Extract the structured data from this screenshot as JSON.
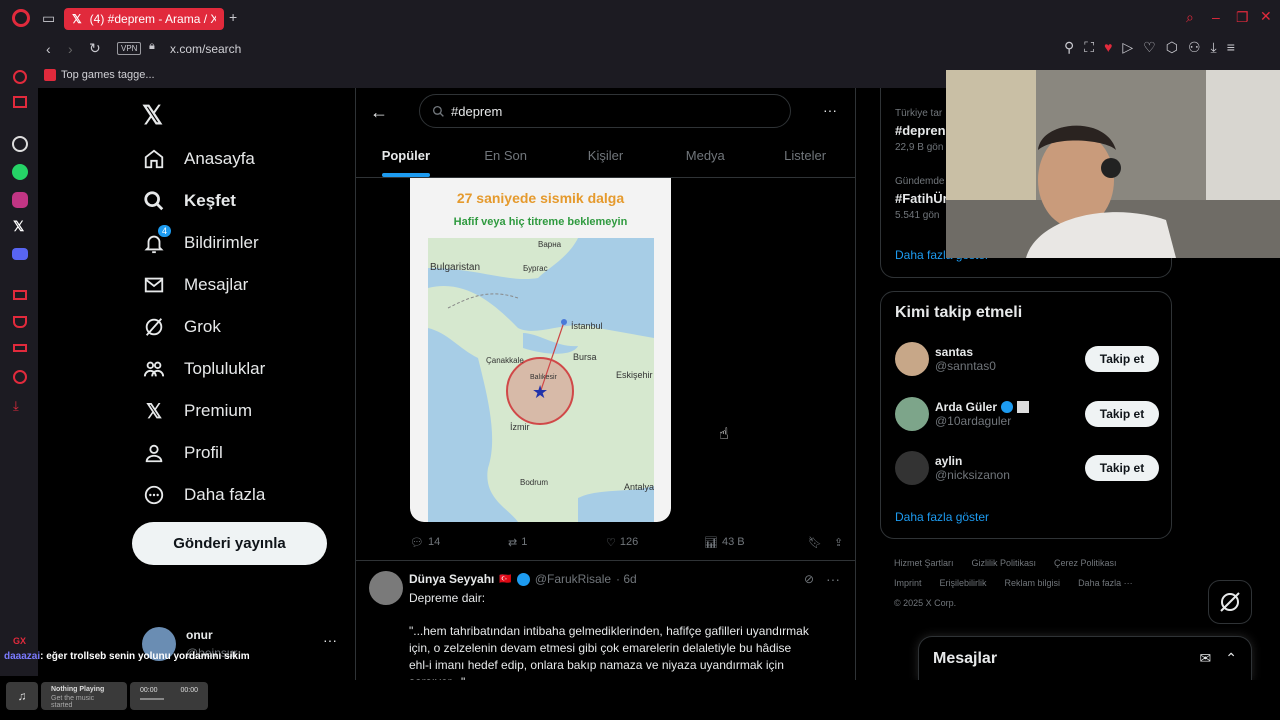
{
  "browser": {
    "tab_title": "(4) #deprem - Arama / X",
    "url": "x.com/search",
    "vpn_label": "VPN",
    "bookmark": "Top games tagge..."
  },
  "nav": {
    "items": [
      {
        "label": "Anasayfa",
        "icon": "home-icon"
      },
      {
        "label": "Keşfet",
        "icon": "search-icon"
      },
      {
        "label": "Bildirimler",
        "icon": "bell-icon",
        "badge": "4"
      },
      {
        "label": "Mesajlar",
        "icon": "mail-icon"
      },
      {
        "label": "Grok",
        "icon": "grok-icon"
      },
      {
        "label": "Topluluklar",
        "icon": "communities-icon"
      },
      {
        "label": "Premium",
        "icon": "x-logo-icon"
      },
      {
        "label": "Profil",
        "icon": "person-icon"
      },
      {
        "label": "Daha fazla",
        "icon": "more-circle-icon"
      }
    ],
    "post_button": "Gönderi yayınla",
    "account_name": "onur",
    "account_handle": "@beinsur"
  },
  "search": {
    "query": "#deprem",
    "tabs": [
      "Popüler",
      "En Son",
      "Kişiler",
      "Medya",
      "Listeler"
    ]
  },
  "tweet1": {
    "media_title": "27 saniyede sismik dalga",
    "media_subtitle": "Hafif veya hiç titreme beklemeyin",
    "map_labels": {
      "varna": "Варна",
      "bulgaristan": "Bulgaristan",
      "burgas": "Бургас",
      "istanbul": "İstanbul",
      "bursa": "Bursa",
      "eskisehir": "Eskişehir",
      "balikesir": "Balıkesir",
      "izmir": "İzmir",
      "antalya": "Antalya",
      "bodrum": "Bodrum",
      "canakkale": "Çanakkale"
    },
    "replies": "14",
    "retweets": "1",
    "likes": "126",
    "views": "43 B"
  },
  "tweet2": {
    "name": "Dünya Seyyahı",
    "handle": "@FarukRisale",
    "time": "· 6d",
    "line1": "Depreme dair:",
    "body1": "\"...hem tahribatından intibaha gelmediklerinden, hafifçe gafilleri uyandırmak",
    "body2": "için, o zelzelenin devam etmesi gibi çok emarelerin delaletiyle bu hâdise",
    "body3": "ehl-i imanı hedef edip, onlara bakıp namaza ve niyaza uyandırmak için",
    "body4": "sarsıyor...\""
  },
  "trends": {
    "item1_context": "Türkiye tar",
    "item1_title": "#depren",
    "item1_count": "22,9 B gön",
    "item2_context": "Gündemde",
    "item2_title": "#FatihÜr",
    "item2_count": "5.541 gön",
    "show_more": "Daha fazla göster"
  },
  "who": {
    "title": "Kimi takip etmeli",
    "users": [
      {
        "name": "santas",
        "handle": "@sanntas0",
        "button": "Takip et"
      },
      {
        "name": "Arda Güler",
        "handle": "@10ardaguler",
        "button": "Takip et"
      },
      {
        "name": "aylin",
        "handle": "@nicksizanon",
        "button": "Takip et"
      }
    ],
    "show_more": "Daha fazla göster"
  },
  "footer": {
    "links": [
      "Hizmet Şartları",
      "Gizlilik Politikası",
      "Çerez Politikası",
      "Imprint",
      "Erişilebilirlik",
      "Reklam bilgisi",
      "Daha fazla ···"
    ],
    "copyright": "© 2025 X Corp."
  },
  "messages_drawer": {
    "title": "Mesajlar"
  },
  "overlay": {
    "chat_user": "daaazai",
    "chat_text": ": eğer trollseb senin yolunu yordamını sikim",
    "music_title": "Nothing Playing",
    "music_sub": "Get the music started",
    "time_left": "00:00",
    "time_right": "00:00"
  },
  "colors": {
    "accent": "#1d9bf0",
    "opera_red": "#e12a3c",
    "bg": "#000000",
    "border": "#2f3336"
  }
}
